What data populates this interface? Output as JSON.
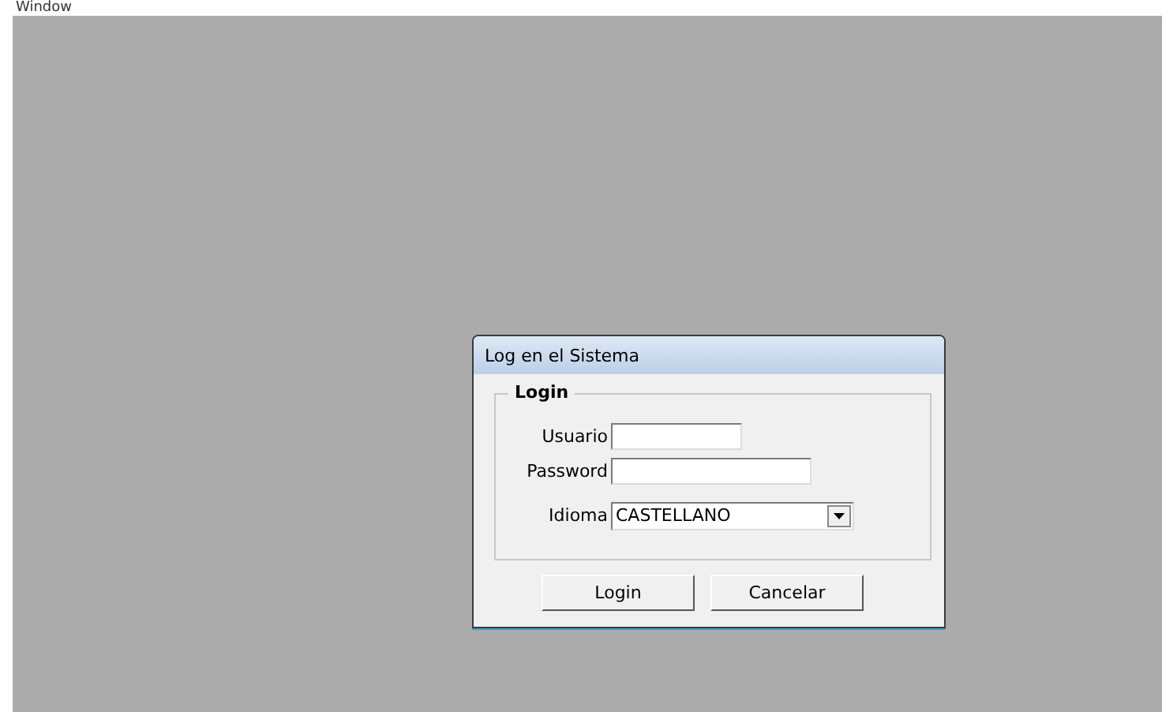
{
  "menu_bar": {
    "items": [
      "Window"
    ]
  },
  "dialog": {
    "title": "Log en el Sistema",
    "group": {
      "title": "Login",
      "fields": [
        {
          "kind": "text",
          "label": "Usuario"
        },
        {
          "kind": "text",
          "label": "Password"
        },
        {
          "kind": "dropdown",
          "label": "Idioma",
          "value": "CASTELLANO"
        }
      ]
    },
    "buttons": [
      "Login",
      "Cancelar"
    ]
  }
}
